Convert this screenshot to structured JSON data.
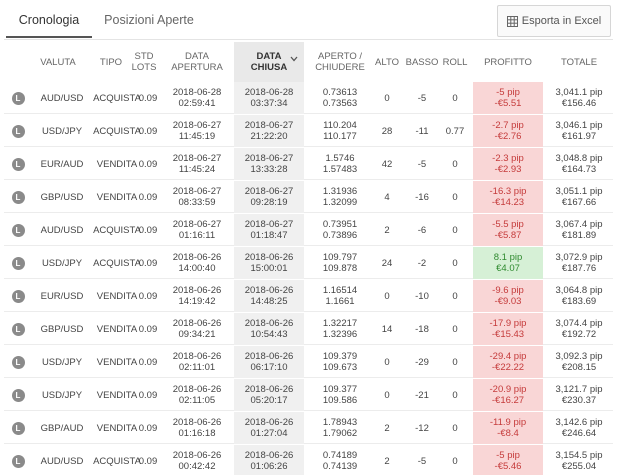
{
  "tabs": {
    "active": "Cronologia",
    "inactive": "Posizioni Aperte"
  },
  "export_label": "Esporta in Excel",
  "columns": {
    "valuta": "VALUTA",
    "tipo": "TIPO",
    "std_lots": [
      "STD",
      "LOTS"
    ],
    "data_apertura": [
      "DATA",
      "APERTURA"
    ],
    "data_chiusa": [
      "DATA",
      "CHIUSA"
    ],
    "aperto_chiudere": [
      "APERTO /",
      "CHIUDERE"
    ],
    "alto": "ALTO",
    "basso": "BASSO",
    "roll": "ROLL",
    "profitto": "PROFITTO",
    "totale": "TOTALE"
  },
  "icon_letter": "L",
  "colors": {
    "profit_negative_bg": "#f9d6d6",
    "profit_negative_text": "#c53b3b",
    "profit_positive_bg": "#d6f0d6",
    "profit_positive_text": "#2f8a2f",
    "sorted_column_bg": "#e9e9e9"
  },
  "rows": [
    {
      "valuta": "AUD/USD",
      "tipo": "ACQUISTA",
      "lots": "0.09",
      "open_date": "2018-06-28",
      "open_time": "02:59:41",
      "close_date": "2018-06-28",
      "close_time": "03:37:34",
      "open_price": "0.73613",
      "close_price": "0.73563",
      "alto": "0",
      "basso": "-5",
      "roll": "0",
      "profit_pip": "-5 pip",
      "profit_eur": "-€5.51",
      "profit_positive": false,
      "total_pip": "3,041.1 pip",
      "total_eur": "€156.46"
    },
    {
      "valuta": "USD/JPY",
      "tipo": "ACQUISTA",
      "lots": "0.09",
      "open_date": "2018-06-27",
      "open_time": "11:45:19",
      "close_date": "2018-06-27",
      "close_time": "21:22:20",
      "open_price": "110.204",
      "close_price": "110.177",
      "alto": "28",
      "basso": "-11",
      "roll": "0.77",
      "profit_pip": "-2.7 pip",
      "profit_eur": "-€2.76",
      "profit_positive": false,
      "total_pip": "3,046.1 pip",
      "total_eur": "€161.97"
    },
    {
      "valuta": "EUR/AUD",
      "tipo": "VENDITA",
      "lots": "0.09",
      "open_date": "2018-06-27",
      "open_time": "11:45:24",
      "close_date": "2018-06-27",
      "close_time": "13:33:28",
      "open_price": "1.5746",
      "close_price": "1.57483",
      "alto": "42",
      "basso": "-5",
      "roll": "0",
      "profit_pip": "-2.3 pip",
      "profit_eur": "-€2.93",
      "profit_positive": false,
      "total_pip": "3,048.8 pip",
      "total_eur": "€164.73"
    },
    {
      "valuta": "GBP/USD",
      "tipo": "VENDITA",
      "lots": "0.09",
      "open_date": "2018-06-27",
      "open_time": "08:33:59",
      "close_date": "2018-06-27",
      "close_time": "09:28:19",
      "open_price": "1.31936",
      "close_price": "1.32099",
      "alto": "4",
      "basso": "-16",
      "roll": "0",
      "profit_pip": "-16.3 pip",
      "profit_eur": "-€14.23",
      "profit_positive": false,
      "total_pip": "3,051.1 pip",
      "total_eur": "€167.66"
    },
    {
      "valuta": "AUD/USD",
      "tipo": "ACQUISTA",
      "lots": "0.09",
      "open_date": "2018-06-27",
      "open_time": "01:16:11",
      "close_date": "2018-06-27",
      "close_time": "01:18:47",
      "open_price": "0.73951",
      "close_price": "0.73896",
      "alto": "2",
      "basso": "-6",
      "roll": "0",
      "profit_pip": "-5.5 pip",
      "profit_eur": "-€5.87",
      "profit_positive": false,
      "total_pip": "3,067.4 pip",
      "total_eur": "€181.89"
    },
    {
      "valuta": "USD/JPY",
      "tipo": "ACQUISTA",
      "lots": "0.09",
      "open_date": "2018-06-26",
      "open_time": "14:00:40",
      "close_date": "2018-06-26",
      "close_time": "15:00:01",
      "open_price": "109.797",
      "close_price": "109.878",
      "alto": "24",
      "basso": "-2",
      "roll": "0",
      "profit_pip": "8.1 pip",
      "profit_eur": "€4.07",
      "profit_positive": true,
      "total_pip": "3,072.9 pip",
      "total_eur": "€187.76"
    },
    {
      "valuta": "EUR/USD",
      "tipo": "VENDITA",
      "lots": "0.09",
      "open_date": "2018-06-26",
      "open_time": "14:19:42",
      "close_date": "2018-06-26",
      "close_time": "14:48:25",
      "open_price": "1.16514",
      "close_price": "1.1661",
      "alto": "0",
      "basso": "-10",
      "roll": "0",
      "profit_pip": "-9.6 pip",
      "profit_eur": "-€9.03",
      "profit_positive": false,
      "total_pip": "3,064.8 pip",
      "total_eur": "€183.69"
    },
    {
      "valuta": "GBP/USD",
      "tipo": "VENDITA",
      "lots": "0.09",
      "open_date": "2018-06-26",
      "open_time": "09:34:21",
      "close_date": "2018-06-26",
      "close_time": "10:54:43",
      "open_price": "1.32217",
      "close_price": "1.32396",
      "alto": "14",
      "basso": "-18",
      "roll": "0",
      "profit_pip": "-17.9 pip",
      "profit_eur": "-€15.43",
      "profit_positive": false,
      "total_pip": "3,074.4 pip",
      "total_eur": "€192.72"
    },
    {
      "valuta": "USD/JPY",
      "tipo": "VENDITA",
      "lots": "0.09",
      "open_date": "2018-06-26",
      "open_time": "02:11:01",
      "close_date": "2018-06-26",
      "close_time": "06:17:10",
      "open_price": "109.379",
      "close_price": "109.673",
      "alto": "0",
      "basso": "-29",
      "roll": "0",
      "profit_pip": "-29.4 pip",
      "profit_eur": "-€22.22",
      "profit_positive": false,
      "total_pip": "3,092.3 pip",
      "total_eur": "€208.15"
    },
    {
      "valuta": "USD/JPY",
      "tipo": "VENDITA",
      "lots": "0.09",
      "open_date": "2018-06-26",
      "open_time": "02:11:05",
      "close_date": "2018-06-26",
      "close_time": "05:20:17",
      "open_price": "109.377",
      "close_price": "109.586",
      "alto": "0",
      "basso": "-21",
      "roll": "0",
      "profit_pip": "-20.9 pip",
      "profit_eur": "-€16.27",
      "profit_positive": false,
      "total_pip": "3,121.7 pip",
      "total_eur": "€230.37"
    },
    {
      "valuta": "GBP/AUD",
      "tipo": "VENDITA",
      "lots": "0.09",
      "open_date": "2018-06-26",
      "open_time": "01:16:18",
      "close_date": "2018-06-26",
      "close_time": "01:27:04",
      "open_price": "1.78943",
      "close_price": "1.79062",
      "alto": "2",
      "basso": "-12",
      "roll": "0",
      "profit_pip": "-11.9 pip",
      "profit_eur": "-€8.4",
      "profit_positive": false,
      "total_pip": "3,142.6 pip",
      "total_eur": "€246.64"
    },
    {
      "valuta": "AUD/USD",
      "tipo": "ACQUISTA",
      "lots": "0.09",
      "open_date": "2018-06-26",
      "open_time": "00:42:42",
      "close_date": "2018-06-26",
      "close_time": "01:06:26",
      "open_price": "0.74189",
      "close_price": "0.74139",
      "alto": "2",
      "basso": "-5",
      "roll": "0",
      "profit_pip": "-5 pip",
      "profit_eur": "-€5.46",
      "profit_positive": false,
      "total_pip": "3,154.5 pip",
      "total_eur": "€255.04"
    }
  ]
}
